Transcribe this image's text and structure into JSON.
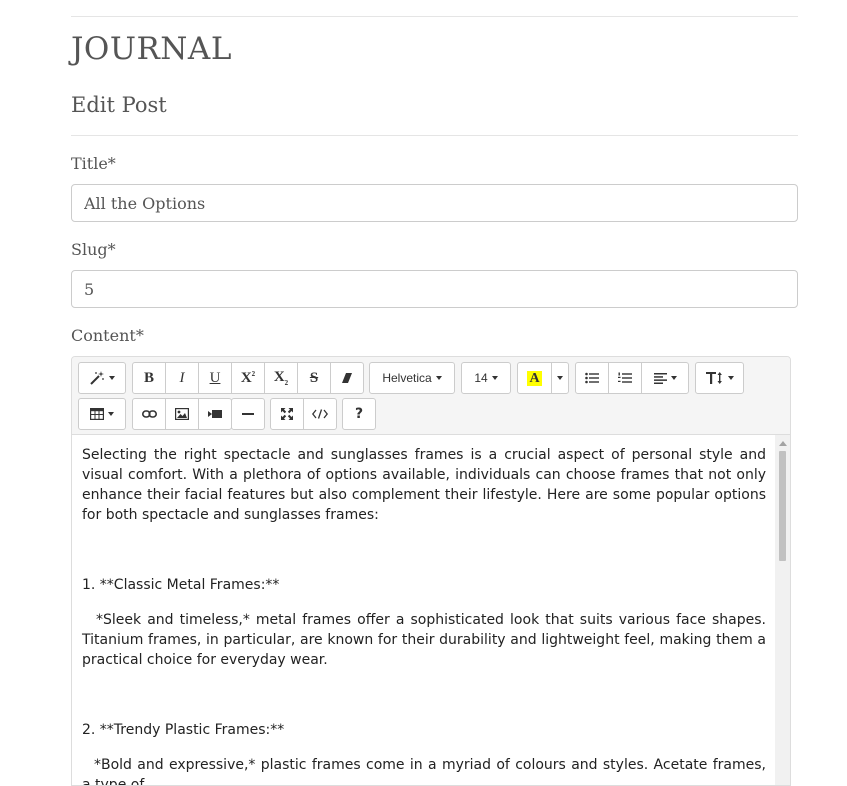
{
  "brand": "JOURNAL",
  "page_title": "Edit Post",
  "form": {
    "title_label": "Title*",
    "title_value": "All the Options",
    "slug_label": "Slug*",
    "slug_value": "5",
    "content_label": "Content*"
  },
  "toolbar": {
    "font_family": "Helvetica",
    "font_size": "14",
    "highlight_color": "#ffff00"
  },
  "content": {
    "paragraphs": [
      "Selecting the right spectacle and sunglasses frames is a crucial aspect of personal style and visual comfort. With a plethora of options available, individuals can choose frames that not only enhance their facial features but also complement their lifestyle. Here are some popular options for both spectacle and sunglasses frames:",
      "1. **Classic Metal Frames:**",
      "*Sleek and timeless,* metal frames offer a sophisticated look that suits various face shapes. Titanium frames, in particular, are known for their durability and lightweight feel, making them a practical choice for everyday wear.",
      "2. **Trendy Plastic Frames:**",
      "*Bold and expressive,* plastic frames come in a myriad of colours and styles. Acetate frames, a type of"
    ]
  }
}
